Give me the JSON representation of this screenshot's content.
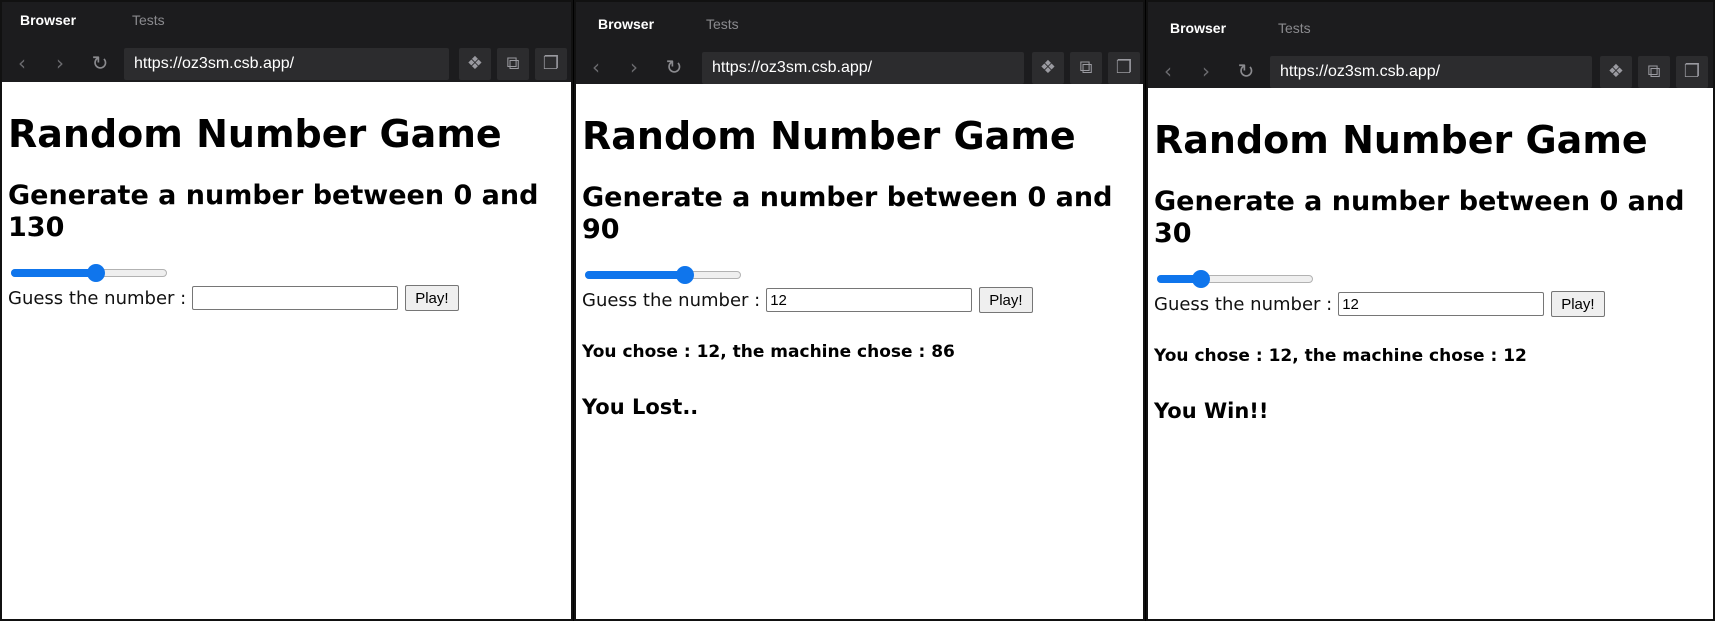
{
  "panels": [
    {
      "tabs": {
        "active": "Browser",
        "inactive": "Tests"
      },
      "url": "https://oz3sm.csb.app/",
      "title": "Random Number Game",
      "subtitle": "Generate a number between 0 and 130",
      "slider_value": 0.55,
      "guess_label": "Guess the number :",
      "guess_value": "",
      "play_label": "Play!",
      "result_text": "",
      "outcome_text": ""
    },
    {
      "tabs": {
        "active": "Browser",
        "inactive": "Tests"
      },
      "url": "https://oz3sm.csb.app/",
      "title": "Random Number Game",
      "subtitle": "Generate a number between 0 and 90",
      "slider_value": 0.66,
      "guess_label": "Guess the number :",
      "guess_value": "12",
      "play_label": "Play!",
      "result_text": "You chose : 12, the machine chose : 86",
      "outcome_text": "You Lost.."
    },
    {
      "tabs": {
        "active": "Browser",
        "inactive": "Tests"
      },
      "url": "https://oz3sm.csb.app/",
      "title": "Random Number Game",
      "subtitle": "Generate a number between 0 and 30",
      "slider_value": 0.25,
      "guess_label": "Guess the number :",
      "guess_value": "12",
      "play_label": "Play!",
      "result_text": "You chose : 12, the machine chose : 12",
      "outcome_text": "You Win!!"
    }
  ],
  "icons": {
    "back": "chevron-left-icon",
    "forward": "chevron-right-icon",
    "reload": "reload-icon",
    "tool1": "codesandbox-icon",
    "tool2": "copy-icon",
    "tool3": "new-window-icon"
  },
  "colors": {
    "chrome_bg": "#1c1c1e",
    "urlbar_bg": "#2c2c2e",
    "slider_accent": "#0f75ec"
  }
}
